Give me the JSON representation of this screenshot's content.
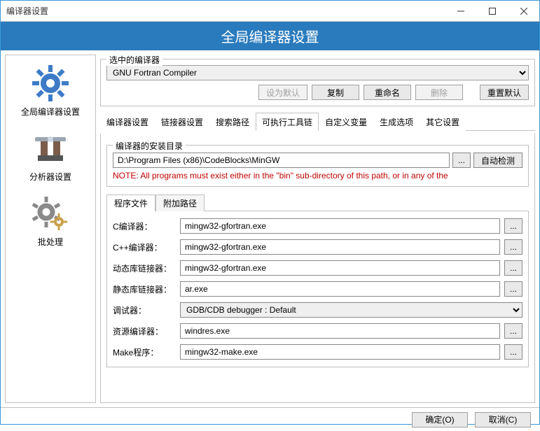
{
  "window": {
    "title": "编译器设置"
  },
  "header": "全局编译器设置",
  "sidebar": {
    "items": [
      {
        "label": "全局编译器设置"
      },
      {
        "label": "分析器设置"
      },
      {
        "label": "批处理"
      }
    ]
  },
  "selected_compiler": {
    "group_title": "选中的编译器",
    "value": "GNU Fortran Compiler",
    "buttons": {
      "set_default": "设为默认",
      "copy": "复制",
      "rename": "重命名",
      "delete": "删除",
      "reset": "重置默认"
    }
  },
  "tabs": [
    "编译器设置",
    "链接器设置",
    "搜索路径",
    "可执行工具链",
    "自定义变量",
    "生成选项",
    "其它设置"
  ],
  "active_tab": 3,
  "install": {
    "group_title": "编译器的安装目录",
    "path": "D:\\Program Files (x86)\\CodeBlocks\\MinGW",
    "browse": "...",
    "auto_detect": "自动检测",
    "note": "NOTE: All programs must exist either in the \"bin\" sub-directory of this path, or in any of the"
  },
  "inner_tabs": [
    "程序文件",
    "附加路径"
  ],
  "programs": {
    "rows": [
      {
        "label": "C编译器：",
        "value": "mingw32-gfortran.exe"
      },
      {
        "label": "C++编译器：",
        "value": "mingw32-gfortran.exe"
      },
      {
        "label": "动态库链接器：",
        "value": "mingw32-gfortran.exe"
      },
      {
        "label": "静态库链接器：",
        "value": "ar.exe"
      },
      {
        "label": "调试器：",
        "value": "GDB/CDB debugger : Default",
        "type": "select"
      },
      {
        "label": "资源编译器：",
        "value": "windres.exe"
      },
      {
        "label": "Make程序：",
        "value": "mingw32-make.exe"
      }
    ],
    "browse": "..."
  },
  "footer": {
    "ok": "确定(O)",
    "cancel": "取消(C)"
  }
}
